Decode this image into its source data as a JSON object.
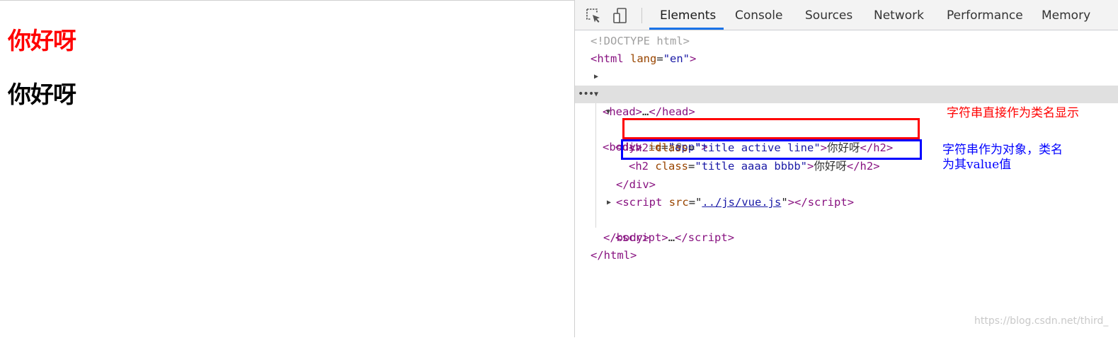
{
  "page": {
    "heading_red": "你好呀",
    "heading_black": "你好呀"
  },
  "devtools": {
    "tabs": [
      "Elements",
      "Console",
      "Sources",
      "Network",
      "Performance",
      "Memory"
    ],
    "active_tab": "Elements",
    "icons": [
      "inspect-element-icon",
      "device-toolbar-icon"
    ]
  },
  "dom": {
    "doctype": "<!DOCTYPE html>",
    "html_tag": "html",
    "html_attr": "lang",
    "html_attr_val": "\"en\"",
    "head": "head",
    "ellipsis": "…",
    "body": "body",
    "body_ref": "== $0",
    "div_tag": "div",
    "div_attr": "id",
    "div_attr_val": "\"app\"",
    "h2_tag": "h2",
    "class_attr": "class",
    "h2_1_class": "\"title active line\"",
    "h2_1_text": "你好呀",
    "h2_2_class": "\"title aaaa bbbb\"",
    "h2_2_text": "你好呀",
    "script_tag": "script",
    "src_attr": "src",
    "script_src": "../js/vue.js"
  },
  "annotations": {
    "red_note": "字符串直接作为类名显示",
    "blue_note": "字符串作为对象，类名\n为其value值"
  },
  "watermark": "https://blog.csdn.net/third_",
  "colors": {
    "red": "#ff0000",
    "blue": "#0000ff",
    "tab_underline": "#1a73e8"
  }
}
